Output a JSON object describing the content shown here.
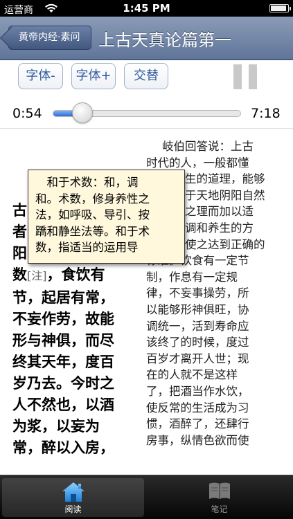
{
  "status_bar": {
    "carrier": "运营商",
    "time": "1:45 PM"
  },
  "nav": {
    "back_label": "黄帝内经·素问",
    "title": "上古天真论篇第一"
  },
  "toolbar": {
    "font_decrease": "字体-",
    "font_increase": "字体+",
    "toggle": "交替"
  },
  "player": {
    "elapsed": "0:54",
    "total": "7:18",
    "progress": 0.123
  },
  "original_text": [
    "古",
    "者",
    "阳",
    "数",
    "节，起居有常，",
    "不妄作劳，故能",
    "形与神俱，而尽",
    "终其天年，度百",
    "岁乃去。今时之",
    "人不然也，以酒",
    "为浆，以妄为",
    "常，醉以入房，"
  ],
  "original_after_note": "，食饮有",
  "note_tag": "[注]",
  "translation_lines": [
    "岐伯回答说：上古",
    "时代的人，一般都懂",
    "生的道理，能够",
    "于天地阴阳自然",
    "之理而加以适",
    "调和养生的方",
    "使之达到正确的",
    "标准。饮食有一定节",
    "制，作息有一定规",
    "律，不妄事操劳，所",
    "以能够形神俱旺，协",
    "调统一，活到寿命应",
    "该终了的时候，度过",
    "百岁才离开人世；现",
    "在的人就不是这样",
    "了，把酒当作水饮，",
    "使反常的生活成为习",
    "惯，酒醉了，还肆行",
    "房事，纵情色欲而使"
  ],
  "popup_lines": [
    "　和于术数：和，调",
    "和。术数，修身养性之",
    "法，如呼吸、导引、按",
    "蹻和静坐法等。和于术",
    "数，指适当的运用导"
  ],
  "tabs": [
    {
      "label": "阅读"
    },
    {
      "label": "笔记"
    }
  ],
  "colors": {
    "nav_top": "#8a9bb7",
    "nav_bottom": "#5f7599",
    "button_text": "#2f5a9c",
    "popup_bg": "#fff8dd",
    "slider_fill": "#2c6fd9"
  }
}
